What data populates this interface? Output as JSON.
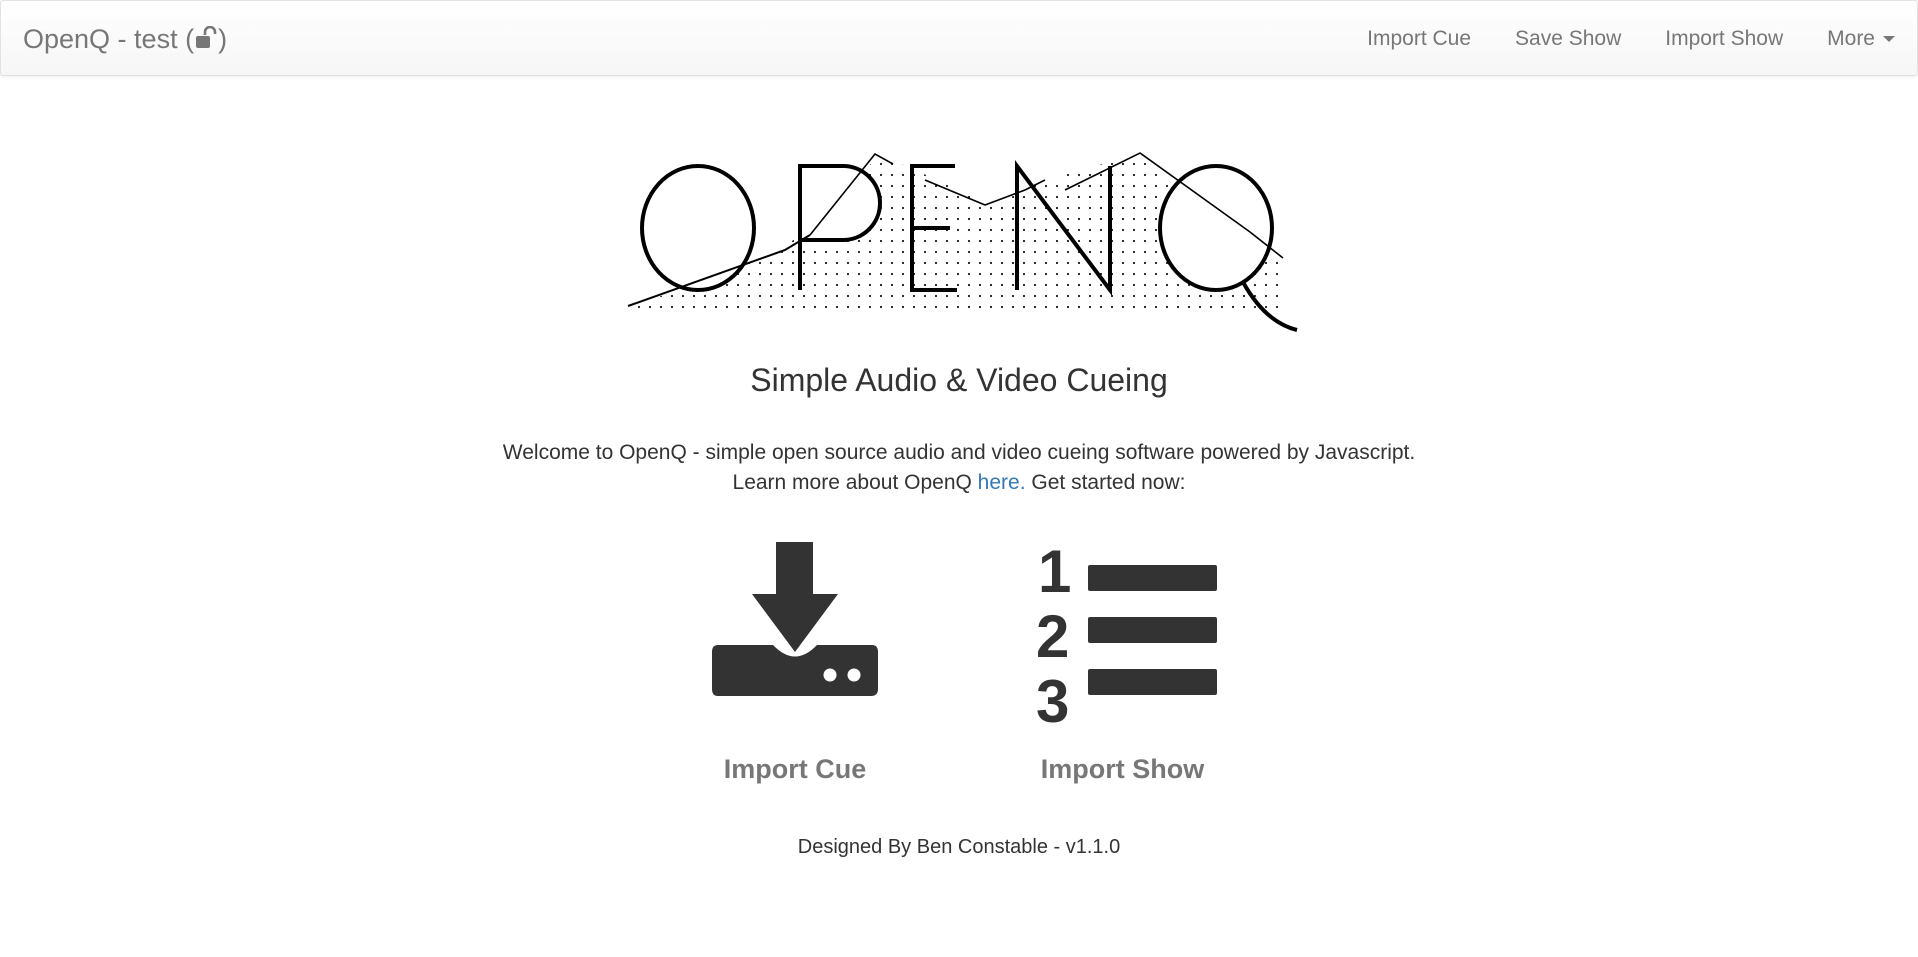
{
  "navbar": {
    "brand": "OpenQ - test (",
    "brand_close": ")",
    "lock_icon": "unlock-icon",
    "items": [
      {
        "label": "Import Cue"
      },
      {
        "label": "Save Show"
      },
      {
        "label": "Import Show"
      },
      {
        "label": "More",
        "icon": "caret-down-icon"
      }
    ]
  },
  "logo": {
    "icon": "openq-logo"
  },
  "subtitle": "Simple Audio & Video Cueing",
  "welcome": {
    "line1": "Welcome to OpenQ - simple open source audio and video cueing software powered by Javascript.",
    "line2_prefix": "Learn more about OpenQ ",
    "link": "here.",
    "line2_suffix": " Get started now:"
  },
  "actions": [
    {
      "label": "Import Cue",
      "icon": "import-icon"
    },
    {
      "label": "Import Show",
      "icon": "numbered-list-icon"
    }
  ],
  "footer": "Designed By Ben Constable - v1.1.0",
  "colors": {
    "nav_text": "#777777",
    "link": "#337ab7",
    "icon": "#333333",
    "text": "#333333"
  }
}
